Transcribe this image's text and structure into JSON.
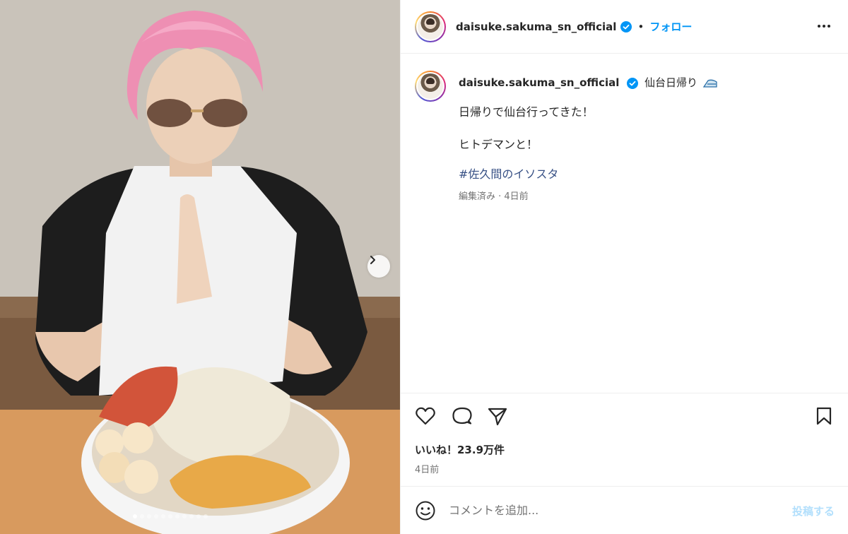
{
  "header": {
    "username": "daisuke.sakuma_sn_official",
    "separator": "•",
    "follow_label": "フォロー"
  },
  "caption": {
    "username": "daisuke.sakuma_sn_official",
    "title": "仙台日帰り",
    "line1": "日帰りで仙台行ってきた！",
    "line2": "ヒトデマンと！",
    "hashtag": "#佐久間のイソスタ",
    "meta": "編集済み · 4日前"
  },
  "engagement": {
    "likes": "いいね！23.9万件",
    "time": "4日前"
  },
  "comment": {
    "placeholder": "コメントを追加...",
    "post_label": "投稿する"
  },
  "carousel": {
    "slide_count": 11,
    "active_index": 0
  },
  "colors": {
    "accent": "#0095f6",
    "verified": "#0095f6",
    "text": "#262626",
    "muted": "#737373",
    "hashtag": "#385185",
    "post_disabled": "#b2dffc"
  },
  "icons": {
    "verified": "verified-badge-icon",
    "more": "more-options-icon",
    "like": "heart-icon",
    "comment": "comment-icon",
    "share": "share-icon",
    "save": "bookmark-icon",
    "emoji": "emoji-icon",
    "next": "chevron-right-icon",
    "title_emoji": "bullet-train-icon"
  }
}
